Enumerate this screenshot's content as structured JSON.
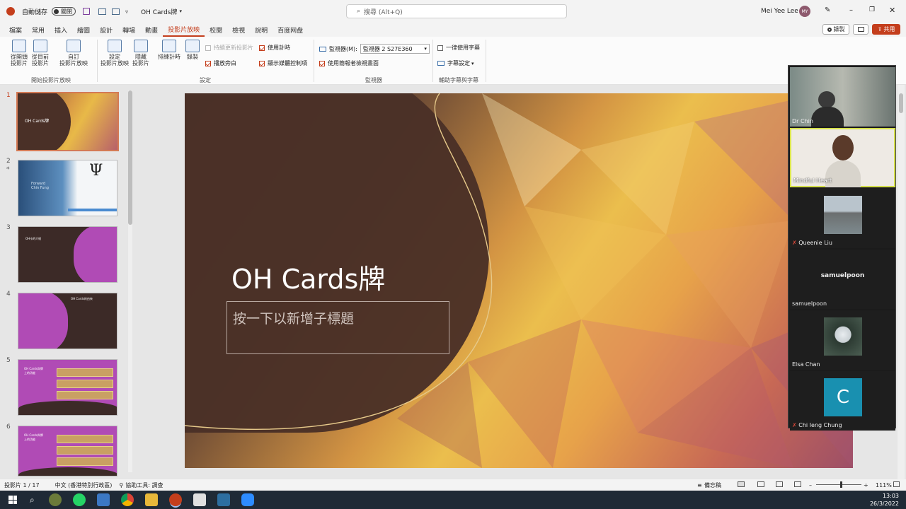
{
  "titlebar": {
    "autosave_label": "自動儲存",
    "autosave_state": "關閉",
    "doc_title": "OH Cards牌",
    "search_placeholder": "搜尋 (Alt+Q)",
    "user_name": "Mei Yee Lee",
    "user_initials": "MY"
  },
  "tabs": [
    "檔案",
    "常用",
    "插入",
    "繪圖",
    "設計",
    "轉場",
    "動畫",
    "投影片放映",
    "校閱",
    "檢視",
    "說明",
    "百度网盘"
  ],
  "tabs_active_index": 7,
  "right_actions": {
    "record": "錄製",
    "share": "共用"
  },
  "ribbon": {
    "start": {
      "from_beginning": "從開頭\n投影片",
      "from_current": "從目前\n投影片",
      "custom": "自訂\n投影片放映",
      "group": "開始投影片放映"
    },
    "setup": {
      "setup_show": "設定\n投影片放映",
      "hide_slide": "隱藏\n投影片",
      "rehearse": "排練計時",
      "record": "錄製",
      "play_narrations": "播放旁白",
      "use_timings": "使用計時",
      "show_media_controls": "顯示媒體控制項",
      "keep_updated": "持續更新投影片",
      "group": "設定"
    },
    "monitors": {
      "monitor_label": "監視器(M):",
      "monitor_value": "監視器 2 S27E360",
      "presenter_view": "使用簡報者檢視畫面",
      "group": "監視器"
    },
    "captions": {
      "always_subtitles": "一律使用字幕",
      "subtitle_settings": "字幕設定",
      "group": "輔助字幕與字幕"
    }
  },
  "thumbnails": {
    "numbers": [
      "1",
      "2",
      "3",
      "4",
      "5",
      "6"
    ],
    "star": "*",
    "slide1_title": "OH Cards牌",
    "slide2_caption": "Forward\nChin Fung",
    "slide2_symbol": "Ψ",
    "slide3_title": "OH卡的介紹",
    "slide4_title": "OH Cards的由來",
    "slide5_title": "OH Cards與牌\n上的功能",
    "slide6_title": "OH Cards與牌\n上的功能"
  },
  "slide": {
    "title": "OH Cards牌",
    "subtitle_placeholder": "按一下以新增子標題"
  },
  "zoom": {
    "participants": [
      "Dr Chin",
      "Mindful Heart",
      "Queenie Liu",
      "samuelpoon",
      "Elsa Chan",
      "Chi Ieng Chung"
    ],
    "tile_center_name": "samuelpoon",
    "avatar_letter": "C"
  },
  "status": {
    "slide_of": "投影片 1 / 17",
    "language": "中文 (香港特別行政區)",
    "accessibility": "協助工具: 調查",
    "notes": "備忘稿",
    "zoom_percent": "111%"
  },
  "taskbar": {
    "time": "13:03",
    "date": "26/3/2022"
  },
  "colors": {
    "accent": "#c43e1c",
    "slide_dark": "#4a3027",
    "taskbar": "#1f2a36"
  }
}
